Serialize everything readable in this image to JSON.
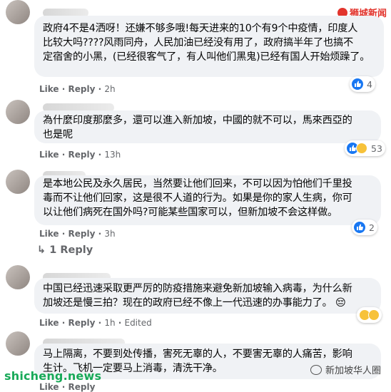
{
  "watermark": {
    "top": "狮城新闻",
    "bottom": "shicheng.news",
    "wechat": "新加坡华人圈"
  },
  "comments": [
    {
      "lines": [
        "政府4不是4洒呀！还嫌不够多哦!每天进来的10个有9个中疫情，印度人",
        "比较大吗????风雨同舟，人民加油已经没有用了，政府搞半年了也搞不",
        "定宿舍的小黑，(已经很客气了，有人叫他们黑鬼)已经有国人开始烦躁了。"
      ],
      "like": "Like",
      "reply": "Reply",
      "time": "2h",
      "reactions": "4"
    },
    {
      "lines": [
        "為什麼印度那麼多，還可以進入新加坡，中國的就不可以，馬來西亞的",
        "也是呢"
      ],
      "like": "Like",
      "reply": "Reply",
      "time": "13h",
      "reactions": "53"
    },
    {
      "lines": [
        "是本地公民及永久居民，当然要让他们回来，不可以因为怕他们千里投",
        "毒而不让他们回家，这是很不人道的行为。如果是你的家人生病，你可",
        "以让他们病死在国外吗?可能某些国家可以，但新加坡不会这样做。"
      ],
      "like": "Like",
      "reply": "Reply",
      "time": "3h",
      "reactions": "2"
    },
    {
      "lines": [
        "中国已经迅速采取更严厉的防疫措施来避免新加坡输入病毒，为什么新",
        "加坡还是慢三拍？现在的政府已经不像上一代迅速的办事能力了。"
      ],
      "emoji": "😔",
      "like": "Like",
      "reply": "Reply",
      "time": "1h",
      "edited": "Edited"
    },
    {
      "lines": [
        "马上隔离，不要到处传播，害死无辜的人，不要害无辜的人痛苦，影响",
        "生计。飞机一定要马上消毒，清洗干净。"
      ],
      "like": "Like",
      "reply": "Reply"
    }
  ],
  "reply_thread": {
    "label": "1 Reply"
  },
  "colors": {
    "like_blue": "#1877f2",
    "bubble": "#f0f2f5",
    "meta_gray": "#65676b"
  }
}
